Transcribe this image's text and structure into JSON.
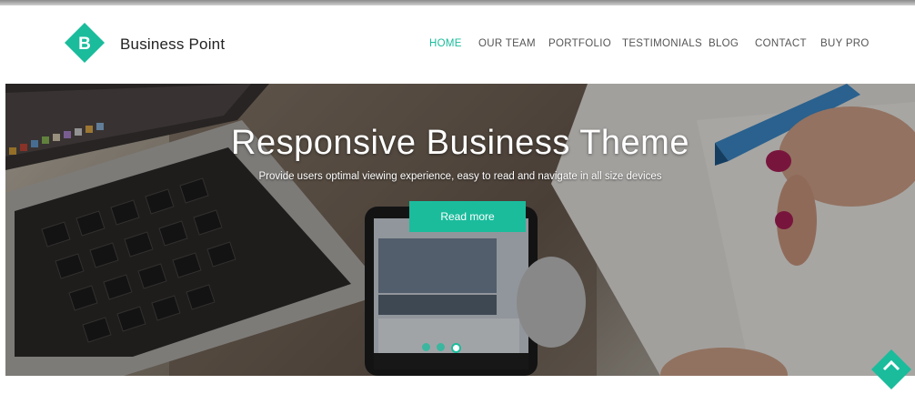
{
  "brand": {
    "logo_letter": "B",
    "name": "Business Point"
  },
  "nav": {
    "items": [
      {
        "label": "HOME",
        "active": true
      },
      {
        "label": "OUR TEAM",
        "active": false
      },
      {
        "label": "PORTFOLIO",
        "active": false
      },
      {
        "label": "TESTIMONIALS",
        "active": false
      },
      {
        "label": "BLOG",
        "active": false
      },
      {
        "label": "CONTACT",
        "active": false
      },
      {
        "label": "BUY PRO",
        "active": false
      }
    ]
  },
  "hero": {
    "title": "Responsive Business Theme",
    "subtitle": "Provide users optimal viewing experience, easy to read and navigate in all size devices",
    "cta_label": "Read more",
    "slides": 3,
    "active_slide": 3
  },
  "icons": {
    "scroll_top": "chevron-up-icon"
  },
  "colors": {
    "accent": "#1abc9c",
    "text": "#555555",
    "white": "#ffffff"
  }
}
